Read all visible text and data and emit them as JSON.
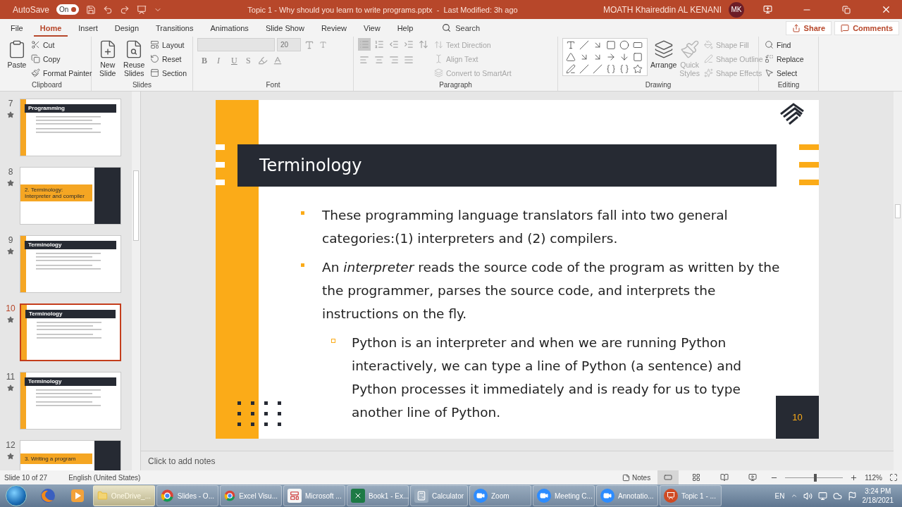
{
  "title_bar": {
    "autosave_label": "AutoSave",
    "autosave": {
      "label": "On",
      "on": true
    },
    "title": "Topic 1 - Why should you learn to write programs.pptx  -  Last Modified: 3h ago",
    "user": "MOATH Khaireddin  AL KENANI",
    "avatar": "MK"
  },
  "tabs": [
    {
      "label": "File",
      "selected": false
    },
    {
      "label": "Home",
      "selected": true
    },
    {
      "label": "Insert",
      "selected": false
    },
    {
      "label": "Design",
      "selected": false
    },
    {
      "label": "Transitions",
      "selected": false
    },
    {
      "label": "Animations",
      "selected": false
    },
    {
      "label": "Slide Show",
      "selected": false
    },
    {
      "label": "Review",
      "selected": false
    },
    {
      "label": "View",
      "selected": false
    },
    {
      "label": "Help",
      "selected": false
    }
  ],
  "search": {
    "placeholder": "Search"
  },
  "share": "Share",
  "comments": "Comments",
  "ribbon": [
    {
      "kind": "clipboard",
      "label": "Clipboard",
      "large": [
        {
          "label": "Paste",
          "disabled": false
        }
      ],
      "small": [
        {
          "label": "Cut",
          "disabled": false
        },
        {
          "label": "Copy",
          "disabled": false
        },
        {
          "label": "Format Painter",
          "disabled": false
        }
      ]
    },
    {
      "kind": "slides",
      "label": "Slides",
      "large": [
        {
          "label": "New Slide",
          "disabled": false
        },
        {
          "label": "Reuse Slides",
          "disabled": false
        }
      ],
      "small": [
        {
          "label": "Layout",
          "disabled": false
        },
        {
          "label": "Reset",
          "disabled": false
        },
        {
          "label": "Section",
          "disabled": false
        }
      ]
    },
    {
      "kind": "font",
      "label": "Font",
      "size": "20",
      "disabled": true,
      "glyphs": [
        "B",
        "I",
        "U",
        "S"
      ]
    },
    {
      "kind": "paragraph",
      "label": "Paragraph",
      "small": [
        {
          "label": "Text Direction",
          "disabled": true
        },
        {
          "label": "Align Text",
          "disabled": true
        },
        {
          "label": "Convert to SmartArt",
          "disabled": true
        }
      ]
    },
    {
      "kind": "drawing",
      "label": "Drawing",
      "large": [
        {
          "label": "Arrange",
          "disabled": false
        },
        {
          "label": "Quick Styles",
          "disabled": true
        }
      ],
      "small": [
        {
          "label": "Shape Fill",
          "disabled": true
        },
        {
          "label": "Shape Outline",
          "disabled": true
        },
        {
          "label": "Shape Effects",
          "disabled": true
        }
      ]
    },
    {
      "kind": "editing",
      "label": "Editing",
      "small": [
        {
          "label": "Find",
          "disabled": false
        },
        {
          "label": "Replace",
          "disabled": false
        },
        {
          "label": "Select",
          "disabled": false
        }
      ]
    }
  ],
  "thumbnails": [
    {
      "number": "7",
      "title": "Programming",
      "kind": "content",
      "selected": false
    },
    {
      "number": "8",
      "title": "2. Terminology: Interpreter and compiler",
      "kind": "section",
      "selected": false
    },
    {
      "number": "9",
      "title": "Terminology",
      "kind": "content",
      "selected": false
    },
    {
      "number": "10",
      "title": "Terminology",
      "kind": "content",
      "selected": true
    },
    {
      "number": "11",
      "title": "Terminology",
      "kind": "content",
      "selected": false
    },
    {
      "number": "12",
      "title": "3. Writing a program",
      "kind": "section",
      "selected": false
    }
  ],
  "slide": {
    "title": "Terminology",
    "bullets": [
      {
        "text": "These programming language translators fall into two general categories:(1) interpreters and (2) compilers."
      },
      {
        "text": "An *interpreter* reads the source code of the program as written by the the programmer, parses the source code, and interprets the instructions on the fly.",
        "children": [
          {
            "text": "Python is an interpreter and when we are running Python interactively, we can type a line of Python (a sentence) and Python processes it immediately and is ready for us to type another line of Python."
          }
        ]
      }
    ],
    "page_number": "10"
  },
  "notes": {
    "placeholder": "Click to add notes"
  },
  "status_bar": {
    "slide_info": "Slide 10 of 27",
    "language": "English (United States)",
    "notes": "Notes",
    "views": [
      {
        "selected": true
      },
      {
        "selected": false
      },
      {
        "selected": false
      },
      {
        "selected": false
      }
    ],
    "zoom": {
      "level": 0.52,
      "reading": "112%"
    }
  },
  "taskbar": {
    "items": [
      {
        "kind": "folder",
        "label": "OneDrive_...",
        "selected": true
      },
      {
        "kind": "chrome",
        "label": "Slides - O...",
        "selected": false
      },
      {
        "kind": "chrome",
        "label": "Excel Visu...",
        "selected": false
      },
      {
        "kind": "app",
        "label": "Microsoft ...",
        "selected": false
      },
      {
        "kind": "excel",
        "label": "Book1 - Ex...",
        "selected": false
      },
      {
        "kind": "calculator",
        "label": "Calculator",
        "selected": false
      },
      {
        "kind": "zoom",
        "label": "Zoom",
        "selected": false
      },
      {
        "kind": "zoom",
        "label": "Meeting C...",
        "selected": false
      },
      {
        "kind": "zoom",
        "label": "Annotatio...",
        "selected": false
      },
      {
        "kind": "powerpoint",
        "label": "Topic 1 - ...",
        "selected": false
      }
    ],
    "language": "EN",
    "time": "3:24 PM",
    "date": "2/18/2021"
  }
}
